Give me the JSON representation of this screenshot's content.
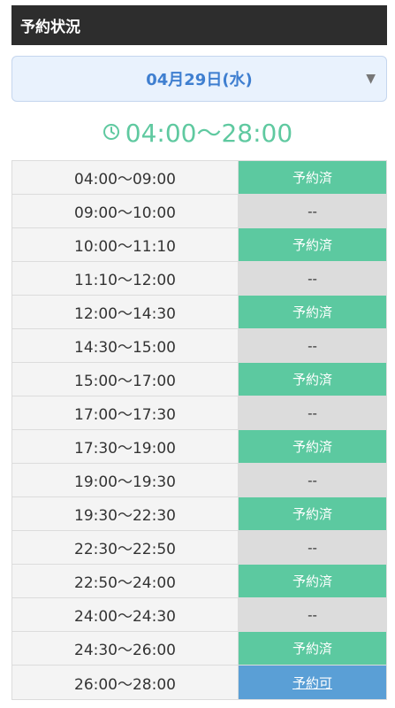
{
  "header": {
    "title": "予約状況"
  },
  "date_select": {
    "value": "04月29日(水)",
    "arrow": "▼"
  },
  "time_range": {
    "text": "04:00〜28:00"
  },
  "slots": [
    {
      "time": "04:00〜09:00",
      "status": "予約済",
      "kind": "booked"
    },
    {
      "time": "09:00〜10:00",
      "status": "--",
      "kind": "none"
    },
    {
      "time": "10:00〜11:10",
      "status": "予約済",
      "kind": "booked"
    },
    {
      "time": "11:10〜12:00",
      "status": "--",
      "kind": "none"
    },
    {
      "time": "12:00〜14:30",
      "status": "予約済",
      "kind": "booked"
    },
    {
      "time": "14:30〜15:00",
      "status": "--",
      "kind": "none"
    },
    {
      "time": "15:00〜17:00",
      "status": "予約済",
      "kind": "booked"
    },
    {
      "time": "17:00〜17:30",
      "status": "--",
      "kind": "none"
    },
    {
      "time": "17:30〜19:00",
      "status": "予約済",
      "kind": "booked"
    },
    {
      "time": "19:00〜19:30",
      "status": "--",
      "kind": "none"
    },
    {
      "time": "19:30〜22:30",
      "status": "予約済",
      "kind": "booked"
    },
    {
      "time": "22:30〜22:50",
      "status": "--",
      "kind": "none"
    },
    {
      "time": "22:50〜24:00",
      "status": "予約済",
      "kind": "booked"
    },
    {
      "time": "24:00〜24:30",
      "status": "--",
      "kind": "none"
    },
    {
      "time": "24:30〜26:00",
      "status": "予約済",
      "kind": "booked"
    },
    {
      "time": "26:00〜28:00",
      "status": "予約可",
      "kind": "available"
    }
  ],
  "colors": {
    "booked": "#5cc9a0",
    "none": "#dcdcdc",
    "available": "#5a9fd6",
    "accent": "#3f7fd0"
  }
}
